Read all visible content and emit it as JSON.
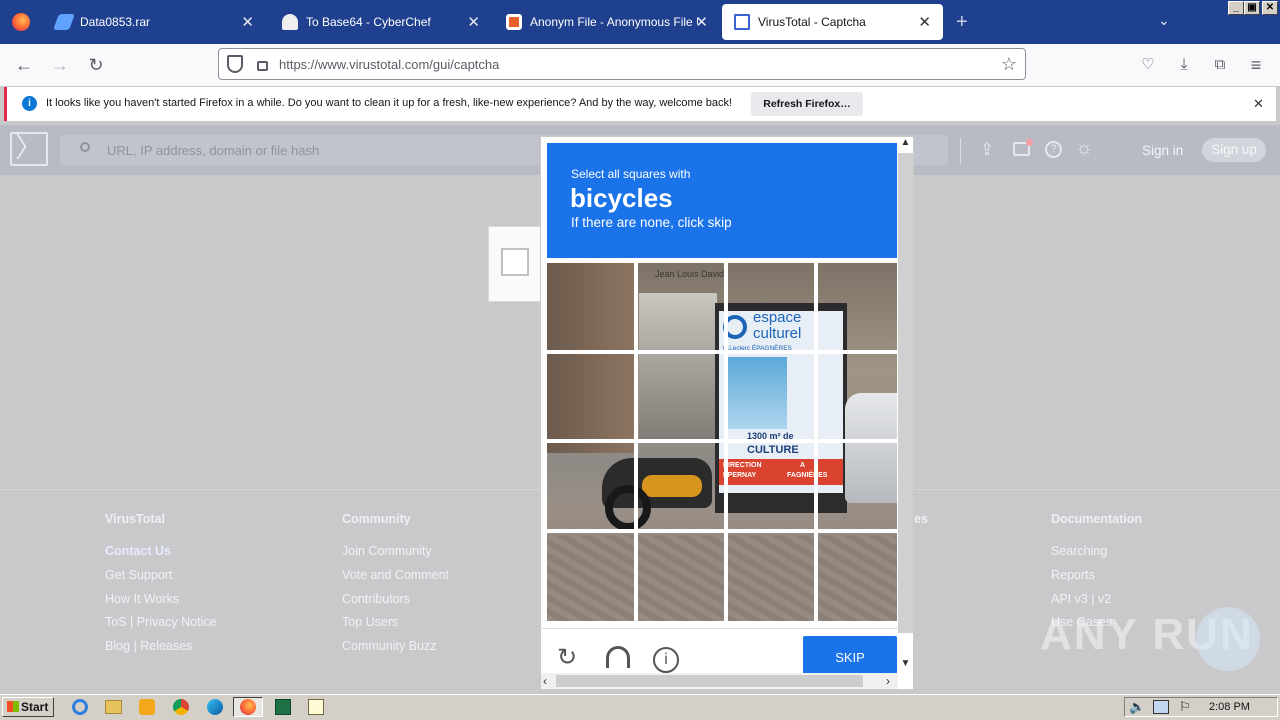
{
  "browser": {
    "tabs": [
      {
        "label": "Data0853.rar",
        "active": false
      },
      {
        "label": "To Base64 - CyberChef",
        "active": false
      },
      {
        "label": "Anonym File - Anonymous File Uplo",
        "active": false
      },
      {
        "label": "VirusTotal - Captcha",
        "active": true
      }
    ],
    "url": "https://www.virustotal.com/gui/captcha",
    "notification": {
      "message": "It looks like you haven't started Firefox in a while. Do you want to clean it up for a fresh, like-new experience? And by the way, welcome back!",
      "button": "Refresh Firefox…"
    }
  },
  "vt_header": {
    "search_placeholder": "URL, IP address, domain or file hash",
    "sign_in": "Sign in",
    "sign_up": "Sign up"
  },
  "footer": {
    "columns": [
      {
        "title": "VirusTotal",
        "links": [
          "Contact Us",
          "Get Support",
          "How It Works",
          "ToS | Privacy Notice",
          "Blog | Releases"
        ]
      },
      {
        "title": "Community",
        "links": [
          "Join Community",
          "Vote and Comment",
          "Contributors",
          "Top Users",
          "Community Buzz"
        ]
      },
      {
        "title": "es",
        "links": []
      },
      {
        "title": "Documentation",
        "links": [
          "Searching",
          "Reports",
          "API v3 | v2",
          "Use Cases"
        ]
      }
    ]
  },
  "captcha": {
    "instruction": "Select all squares with",
    "target": "bicycles",
    "hint": "If there are none, click skip",
    "skip_label": "SKIP",
    "image_sign": [
      "espace",
      "culturel",
      "E.Leclerc ÉPAGNÈRES",
      "1300 m² de",
      "CULTURE",
      "DIRECTION",
      "EPERNAY",
      "A",
      "FAGNIÈRES"
    ],
    "store_sign": "Jean Louis David"
  },
  "watermark": "ANY RUN",
  "taskbar": {
    "start": "Start",
    "time": "2:08 PM"
  }
}
